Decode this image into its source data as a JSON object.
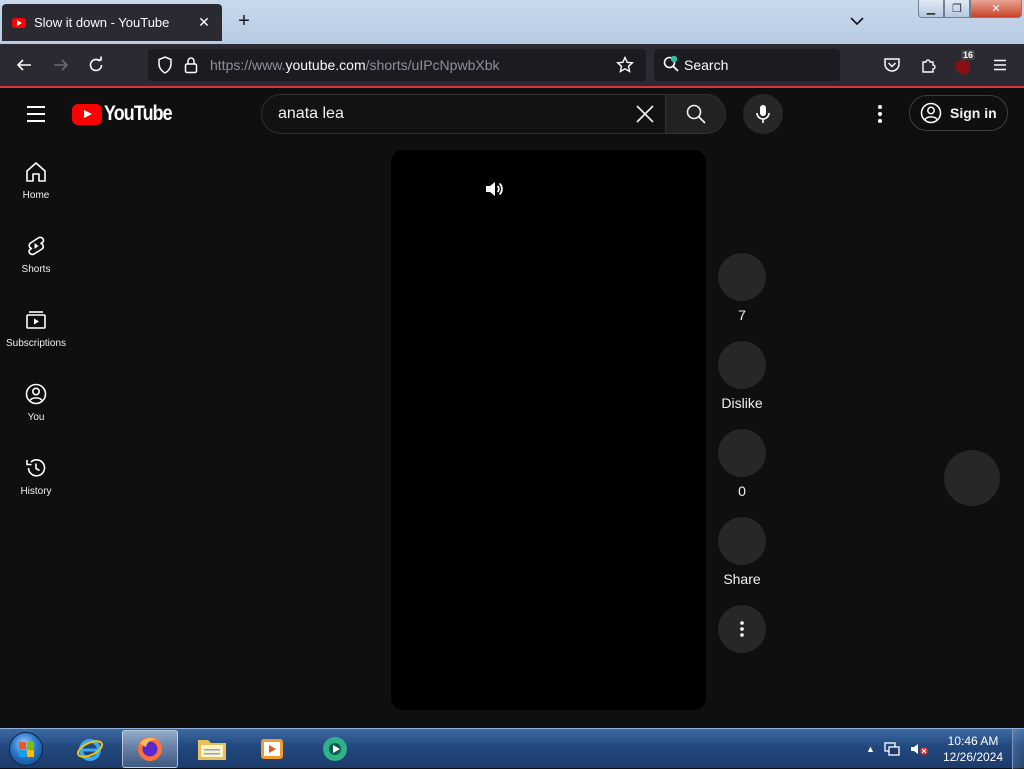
{
  "browser": {
    "tab_title": "Slow it down - YouTube",
    "new_tab_symbol": "+",
    "url_prefix": "https://www.",
    "url_host": "youtube.com",
    "url_path": "/shorts/uIPcNpwbXbk",
    "search_placeholder": "Search",
    "extension_badge": "16"
  },
  "youtube": {
    "logo_text": "YouTube",
    "search_query": "anata lea",
    "sign_in_label": "Sign in",
    "guide": [
      {
        "label": "Home",
        "icon": "home-icon"
      },
      {
        "label": "Shorts",
        "icon": "shorts-icon"
      },
      {
        "label": "Subscriptions",
        "icon": "subscriptions-icon"
      },
      {
        "label": "You",
        "icon": "you-icon"
      },
      {
        "label": "History",
        "icon": "history-icon"
      }
    ],
    "actions": {
      "like_count": "7",
      "dislike_label": "Dislike",
      "comment_count": "0",
      "share_label": "Share"
    }
  },
  "taskbar": {
    "time": "10:46 AM",
    "date": "12/26/2024",
    "pinned": [
      "internet-explorer-icon",
      "firefox-icon",
      "file-explorer-icon",
      "media-player-icon",
      "green-app-icon"
    ]
  },
  "colors": {
    "yt_red": "#ff0000",
    "page_bg": "#0f0f0f",
    "firefox_toolbar": "#2b2a33",
    "accent_line": "#e0323a"
  }
}
